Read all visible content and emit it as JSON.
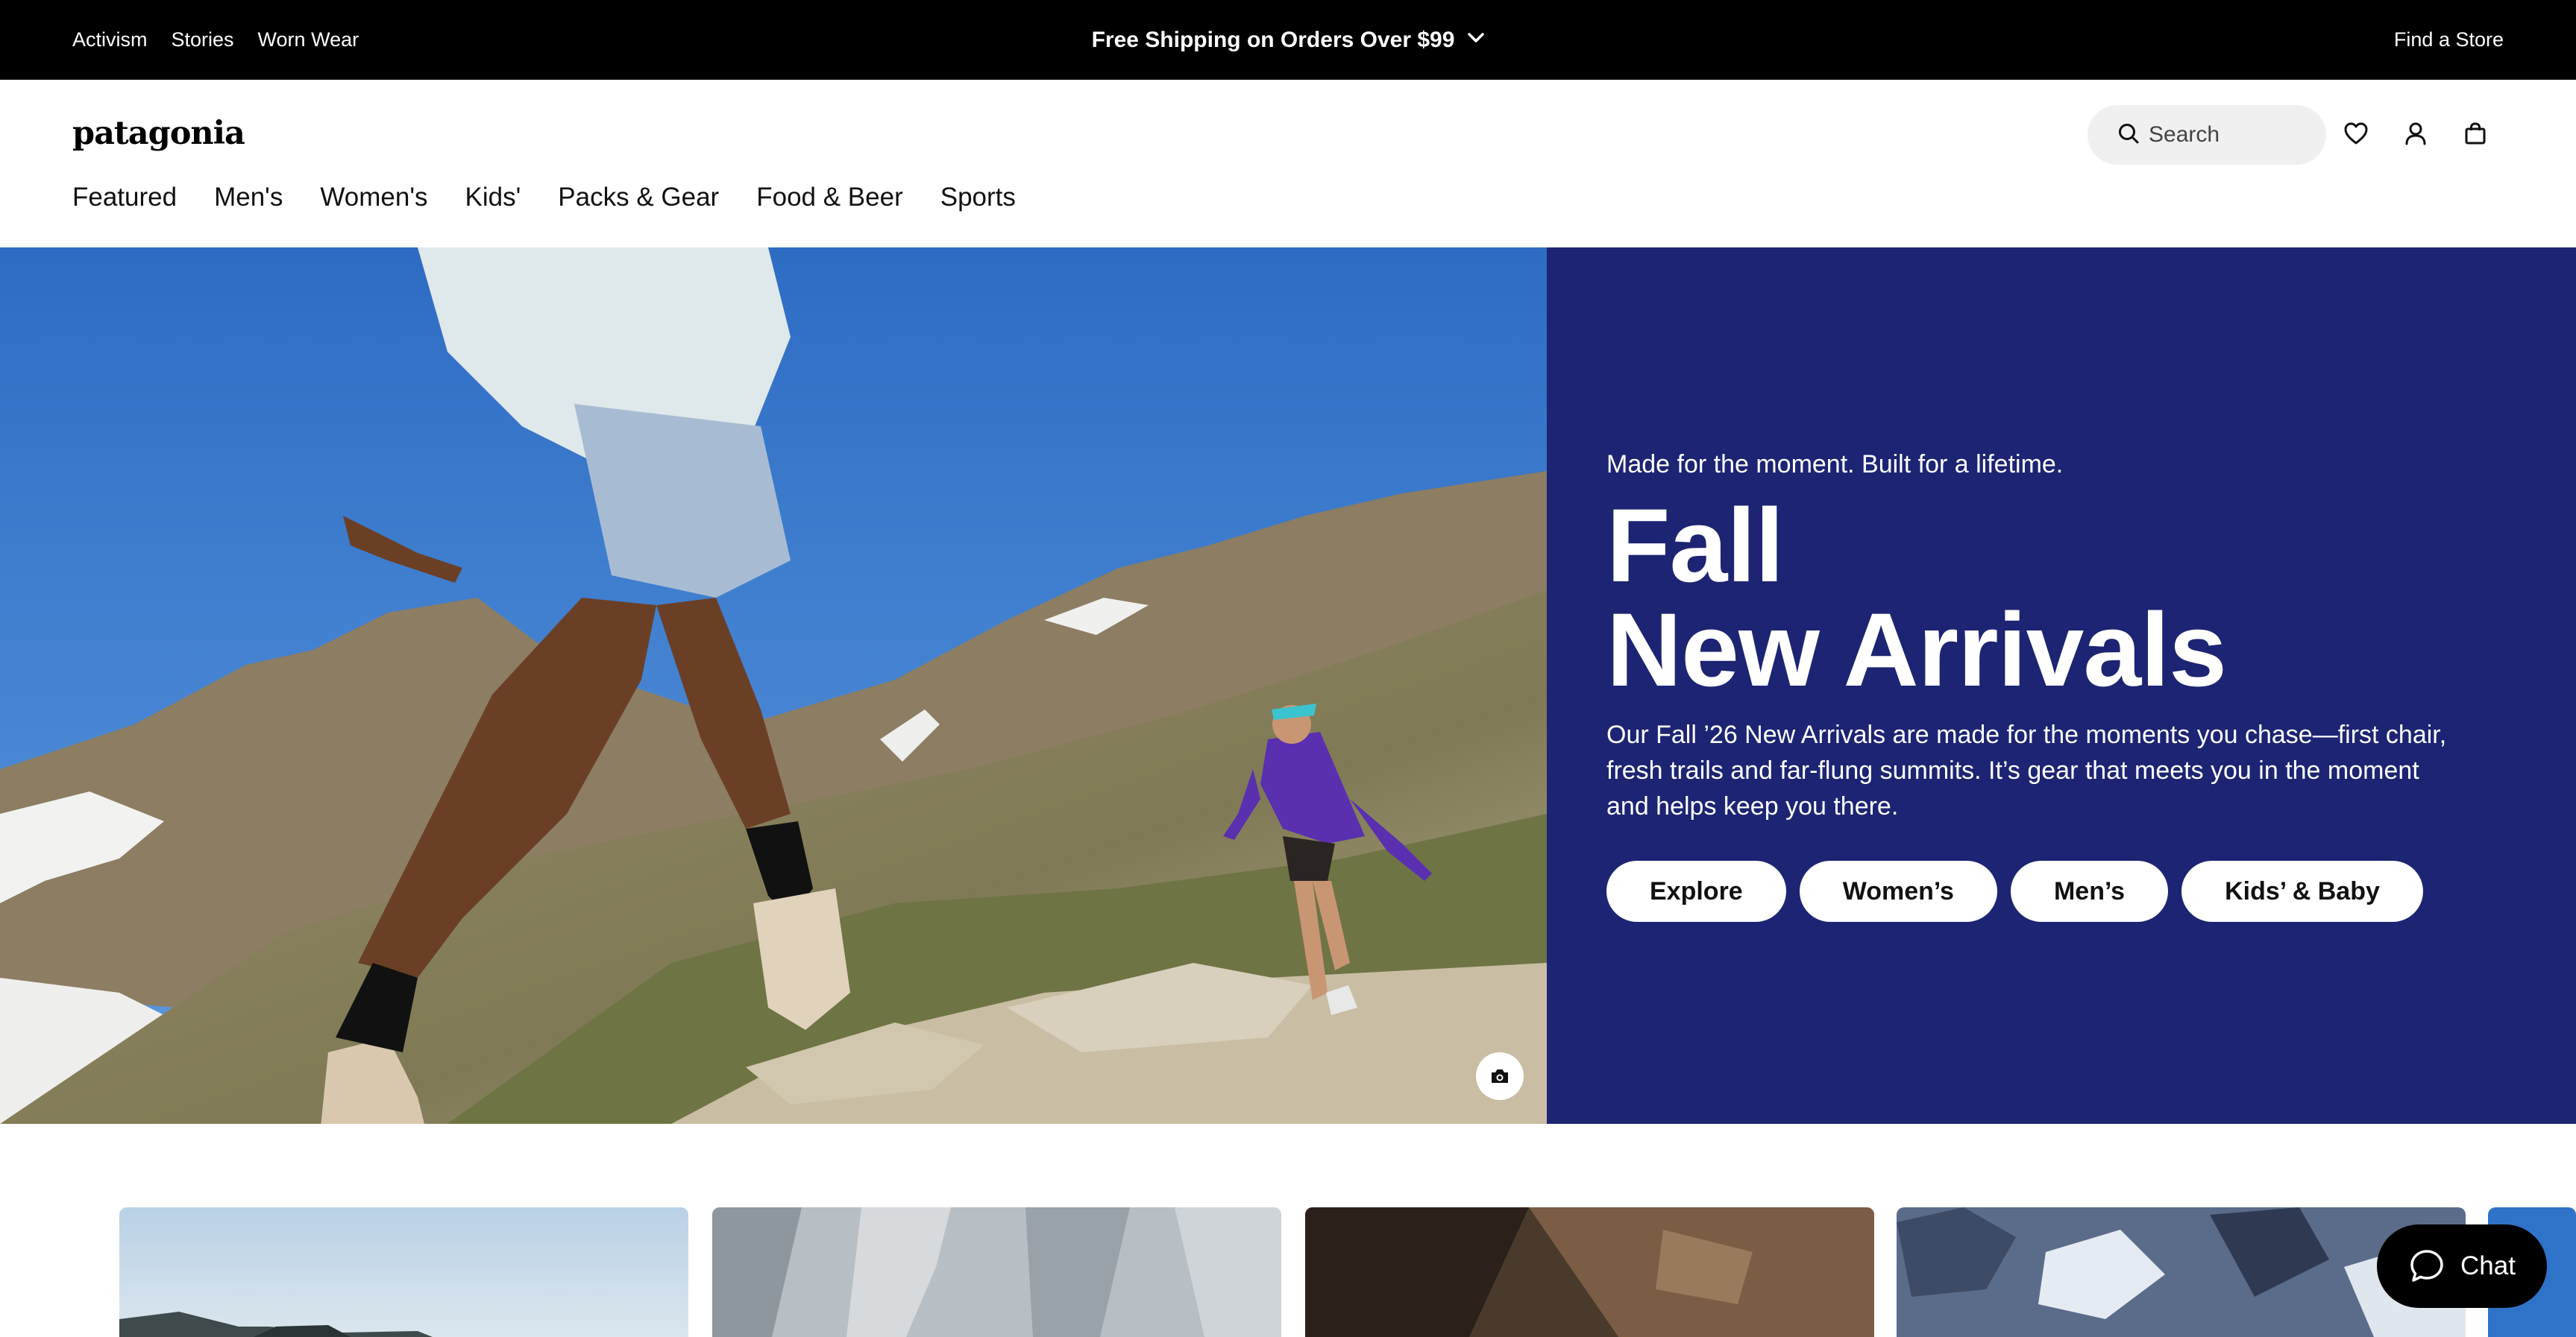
{
  "utility_bar": {
    "links": [
      "Activism",
      "Stories",
      "Worn Wear"
    ],
    "promo": "Free Shipping on Orders Over $99",
    "find_store": "Find a Store"
  },
  "header": {
    "logo": "patagonia",
    "search_placeholder": "Search",
    "nav": [
      "Featured",
      "Men's",
      "Women's",
      "Kids'",
      "Packs & Gear",
      "Food & Beer",
      "Sports"
    ]
  },
  "hero": {
    "eyebrow": "Made for the moment. Built for a lifetime.",
    "title_line1": "Fall",
    "title_line2": "New Arrivals",
    "description": "Our Fall ’26 New Arrivals are made for the moments you chase—first chair, fresh trails and far-flung summits. It’s gear that meets you in the moment and helps keep you there.",
    "buttons": [
      "Explore",
      "Women’s",
      "Men’s",
      "Kids’ & Baby"
    ],
    "panel_color": "#1d2473"
  },
  "chat": {
    "label": "Chat"
  },
  "icons": [
    "search-icon",
    "heart-icon",
    "user-icon",
    "bag-icon",
    "chevron-down-icon",
    "camera-icon",
    "chat-icon"
  ]
}
